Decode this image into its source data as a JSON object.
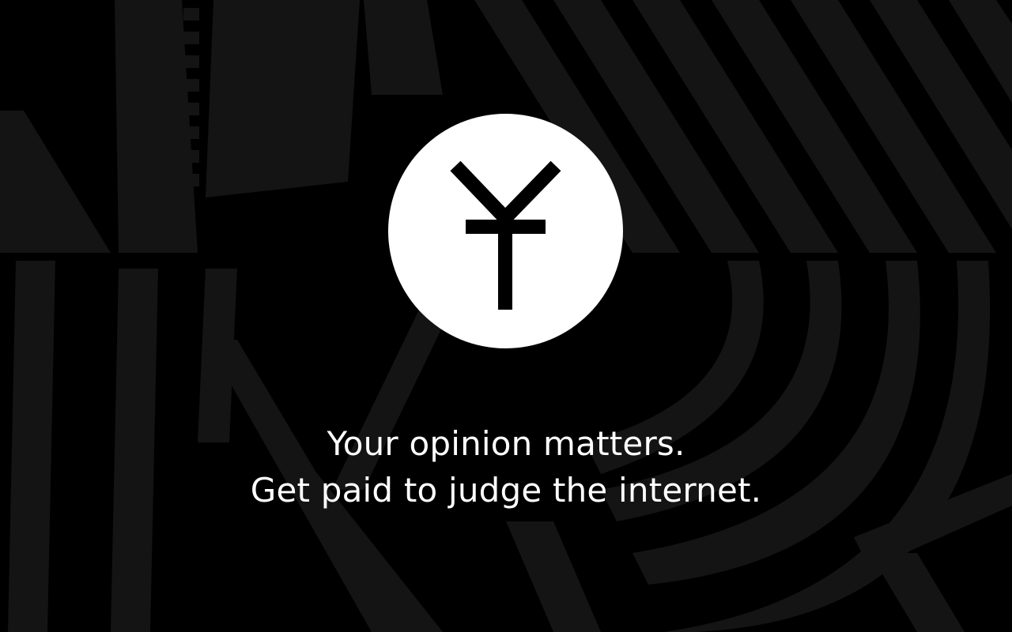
{
  "colors": {
    "background": "#000000",
    "pattern": "#141414",
    "logo_circle": "#ffffff",
    "logo_mark": "#000000",
    "text": "#ffffff"
  },
  "background": {
    "icon": "abstract-striped-pattern"
  },
  "logo": {
    "icon": "y-glyph-icon"
  },
  "tagline": {
    "line1": "Your opinion matters.",
    "line2": "Get paid to judge the internet."
  }
}
